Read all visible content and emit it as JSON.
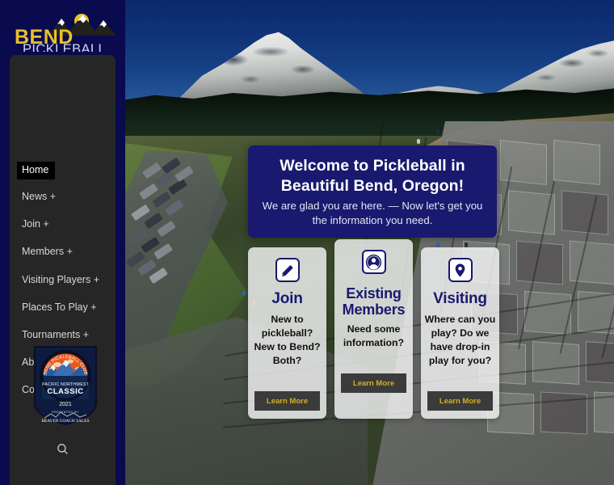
{
  "site": {
    "logo_line1": "BEND",
    "logo_line2": "PICKLEBALL CLUB",
    "brand_yellow": "#e8c02a",
    "brand_navy": "#191970",
    "sidebar_bg": "#262626",
    "page_bg": "#0a0a4e"
  },
  "sidebar": {
    "items": [
      {
        "label": "Home",
        "active": true
      },
      {
        "label": "News +",
        "active": false
      },
      {
        "label": "Join +",
        "active": false
      },
      {
        "label": "Members +",
        "active": false
      },
      {
        "label": "Visiting Players +",
        "active": false
      },
      {
        "label": "Places To Play +",
        "active": false
      },
      {
        "label": "Tournaments +",
        "active": false
      },
      {
        "label": "About +",
        "active": false
      },
      {
        "label": "Contact Us",
        "active": false
      }
    ],
    "search_icon": "search-icon",
    "badge": {
      "arc_text": "BEND PICKLEBALL CLUB",
      "line1": "PACIFIC NORTHWEST",
      "line2": "CLASSIC",
      "year": "2021",
      "presented_by": "PRESENTED BY",
      "sponsor": "BEAVER COACH SALES"
    }
  },
  "hero": {
    "title": "Welcome to Pickleball in Beautiful Bend, Oregon!",
    "subtitle": "We are glad you are here. — Now let's get you the information you need."
  },
  "cards": [
    {
      "icon": "pencil-icon",
      "title": "Join",
      "body": "New to pickleball? New to Bend? Both?",
      "button": "Learn More"
    },
    {
      "icon": "user-circle-icon",
      "title": "Existing Members",
      "body": "Need some information?",
      "button": "Learn More"
    },
    {
      "icon": "map-pin-icon",
      "title": "Visiting",
      "body": "Where can you play? Do we have drop-in play for you?",
      "button": "Learn More"
    }
  ]
}
